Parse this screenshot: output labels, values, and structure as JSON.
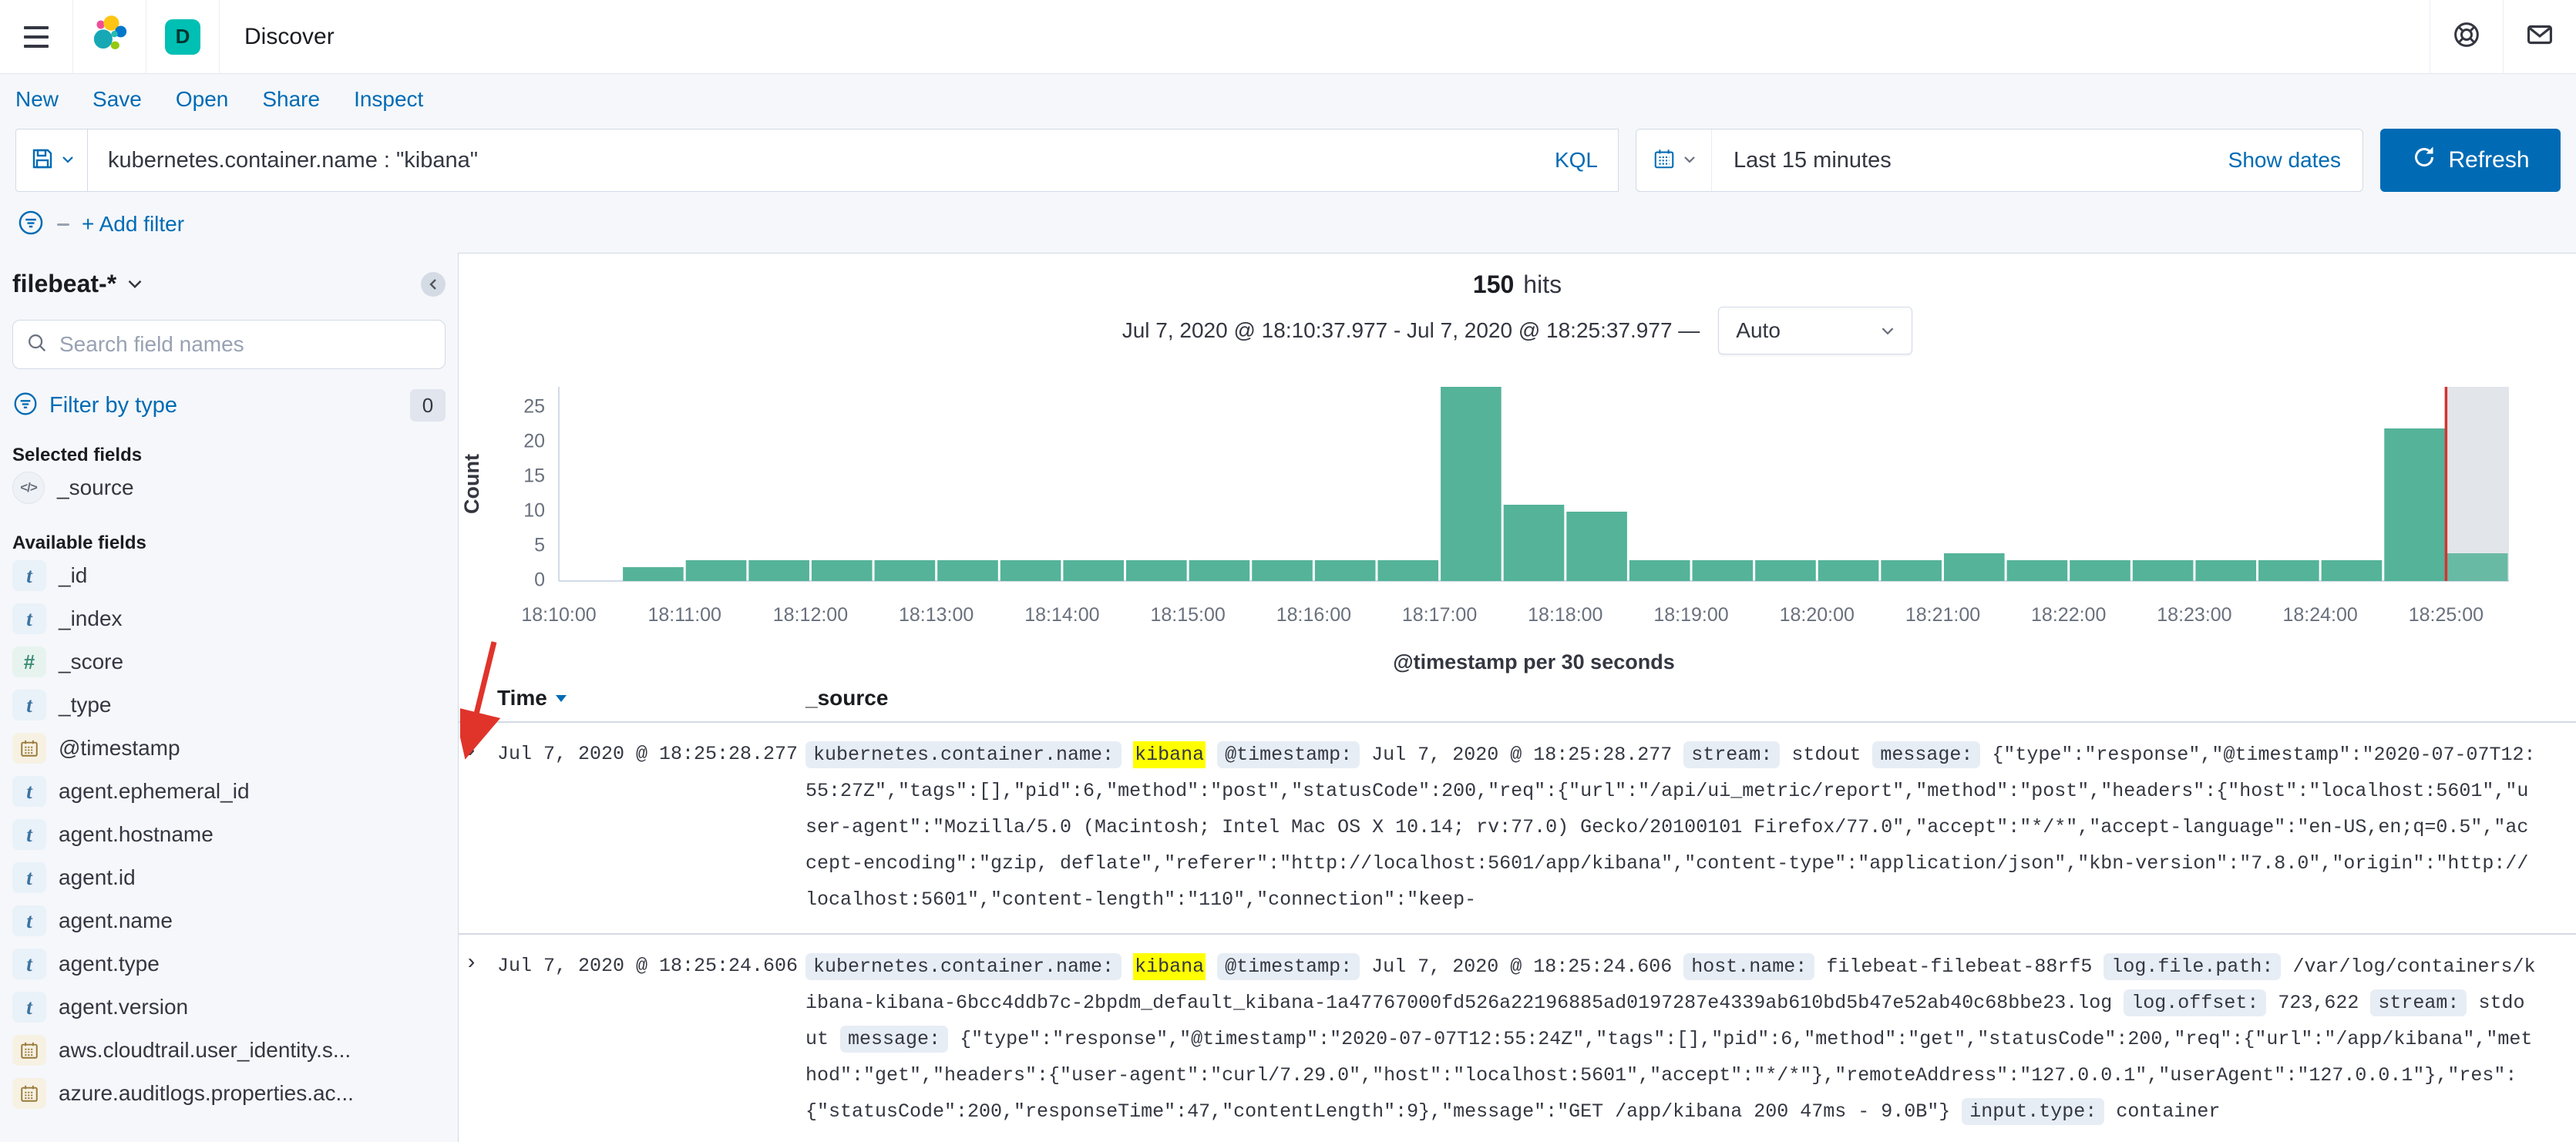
{
  "topbar": {
    "app_title": "Discover",
    "space_initial": "D",
    "space_color": "#00BFB3"
  },
  "nav": {
    "items": [
      "New",
      "Save",
      "Open",
      "Share",
      "Inspect"
    ]
  },
  "query_bar": {
    "query": "kubernetes.container.name : \"kibana\"",
    "language_label": "KQL",
    "time_range": "Last 15 minutes",
    "show_dates_label": "Show dates",
    "refresh_label": "Refresh"
  },
  "filter_bar": {
    "add_filter_label": "+ Add filter"
  },
  "sidebar": {
    "index_pattern": "filebeat-*",
    "search_placeholder": "Search field names",
    "filter_by_type_label": "Filter by type",
    "filter_count": "0",
    "selected_heading": "Selected fields",
    "selected_fields": [
      {
        "name": "_source",
        "type": "source"
      }
    ],
    "available_heading": "Available fields",
    "available_fields": [
      {
        "name": "_id",
        "type": "string"
      },
      {
        "name": "_index",
        "type": "string"
      },
      {
        "name": "_score",
        "type": "number"
      },
      {
        "name": "_type",
        "type": "string"
      },
      {
        "name": "@timestamp",
        "type": "date"
      },
      {
        "name": "agent.ephemeral_id",
        "type": "string"
      },
      {
        "name": "agent.hostname",
        "type": "string"
      },
      {
        "name": "agent.id",
        "type": "string"
      },
      {
        "name": "agent.name",
        "type": "string"
      },
      {
        "name": "agent.type",
        "type": "string"
      },
      {
        "name": "agent.version",
        "type": "string"
      },
      {
        "name": "aws.cloudtrail.user_identity.s...",
        "type": "date"
      },
      {
        "name": "azure.auditlogs.properties.ac...",
        "type": "date"
      }
    ]
  },
  "results": {
    "hits_count": "150",
    "hits_label": "hits",
    "time_range_display": "Jul 7, 2020 @ 18:10:37.977 - Jul 7, 2020 @ 18:25:37.977 —",
    "interval_value": "Auto"
  },
  "chart_data": {
    "type": "bar",
    "ylabel": "Count",
    "xlabel": "@timestamp per 30 seconds",
    "x_start": "18:10:00",
    "bucket_interval_seconds": 30,
    "counts": [
      0,
      2,
      3,
      3,
      3,
      3,
      3,
      3,
      3,
      3,
      3,
      3,
      3,
      3,
      28,
      11,
      10,
      3,
      3,
      3,
      3,
      3,
      4,
      3,
      3,
      3,
      3,
      3,
      3,
      22,
      4
    ],
    "x_tick_labels": [
      "18:10:00",
      "18:11:00",
      "18:12:00",
      "18:13:00",
      "18:14:00",
      "18:15:00",
      "18:16:00",
      "18:17:00",
      "18:18:00",
      "18:19:00",
      "18:20:00",
      "18:21:00",
      "18:22:00",
      "18:23:00",
      "18:24:00",
      "18:25:00"
    ],
    "y_ticks": [
      0,
      5,
      10,
      15,
      20,
      25
    ],
    "ylim": [
      0,
      28
    ],
    "bar_color": "#54B399",
    "current_time_line_color": "#D0362F",
    "partial_bucket_index": 30,
    "total_hits": 150
  },
  "table": {
    "columns": [
      "Time",
      "_source"
    ],
    "rows": [
      {
        "time": "Jul 7, 2020 @ 18:25:28.277",
        "segments": [
          {
            "t": "badge",
            "v": "kubernetes.container.name:"
          },
          {
            "t": "mark",
            "v": "kibana"
          },
          {
            "t": "badge",
            "v": "@timestamp:"
          },
          {
            "t": "text",
            "v": "Jul 7, 2020 @ 18:25:28.277"
          },
          {
            "t": "badge",
            "v": "stream:"
          },
          {
            "t": "text",
            "v": "stdout"
          },
          {
            "t": "badge",
            "v": "message:"
          },
          {
            "t": "text",
            "v": "{\"type\":\"response\",\"@timestamp\":\"2020-07-07T12:55:27Z\",\"tags\":[],\"pid\":6,\"method\":\"post\",\"statusCode\":200,\"req\":{\"url\":\"/api/ui_metric/report\",\"method\":\"post\",\"headers\":{\"host\":\"localhost:5601\",\"user-agent\":\"Mozilla/5.0 (Macintosh; Intel Mac OS X 10.14; rv:77.0) Gecko/20100101 Firefox/77.0\",\"accept\":\"*/*\",\"accept-language\":\"en-US,en;q=0.5\",\"accept-encoding\":\"gzip, deflate\",\"referer\":\"http://localhost:5601/app/kibana\",\"content-type\":\"application/json\",\"kbn-version\":\"7.8.0\",\"origin\":\"http://localhost:5601\",\"content-length\":\"110\",\"connection\":\"keep-"
          }
        ]
      },
      {
        "time": "Jul 7, 2020 @ 18:25:24.606",
        "segments": [
          {
            "t": "badge",
            "v": "kubernetes.container.name:"
          },
          {
            "t": "mark",
            "v": "kibana"
          },
          {
            "t": "badge",
            "v": "@timestamp:"
          },
          {
            "t": "text",
            "v": "Jul 7, 2020 @ 18:25:24.606"
          },
          {
            "t": "badge",
            "v": "host.name:"
          },
          {
            "t": "text",
            "v": "filebeat-filebeat-88rf5"
          },
          {
            "t": "badge",
            "v": "log.file.path:"
          },
          {
            "t": "text",
            "v": "/var/log/containers/kibana-kibana-6bcc4ddb7c-2bpdm_default_kibana-1a47767000fd526a22196885ad0197287e4339ab610bd5b47e52ab40c68bbe23.log"
          },
          {
            "t": "badge",
            "v": "log.offset:"
          },
          {
            "t": "text",
            "v": "723,622"
          },
          {
            "t": "badge",
            "v": "stream:"
          },
          {
            "t": "text",
            "v": "stdout"
          },
          {
            "t": "badge",
            "v": "message:"
          },
          {
            "t": "text",
            "v": "{\"type\":\"response\",\"@timestamp\":\"2020-07-07T12:55:24Z\",\"tags\":[],\"pid\":6,\"method\":\"get\",\"statusCode\":200,\"req\":{\"url\":\"/app/kibana\",\"method\":\"get\",\"headers\":{\"user-agent\":\"curl/7.29.0\",\"host\":\"localhost:5601\",\"accept\":\"*/*\"},\"remoteAddress\":\"127.0.0.1\",\"userAgent\":\"127.0.0.1\"},\"res\":{\"statusCode\":200,\"responseTime\":47,\"contentLength\":9},\"message\":\"GET /app/kibana 200 47ms - 9.0B\"}"
          },
          {
            "t": "badge",
            "v": "input.type:"
          },
          {
            "t": "text",
            "v": "container"
          }
        ]
      }
    ]
  },
  "colors": {
    "accent": "#006BB4",
    "histogram_bar": "#54B399",
    "highlight": "#FFFF00",
    "time_marker": "#D0362F",
    "annotation_arrow": "#E0342B"
  }
}
